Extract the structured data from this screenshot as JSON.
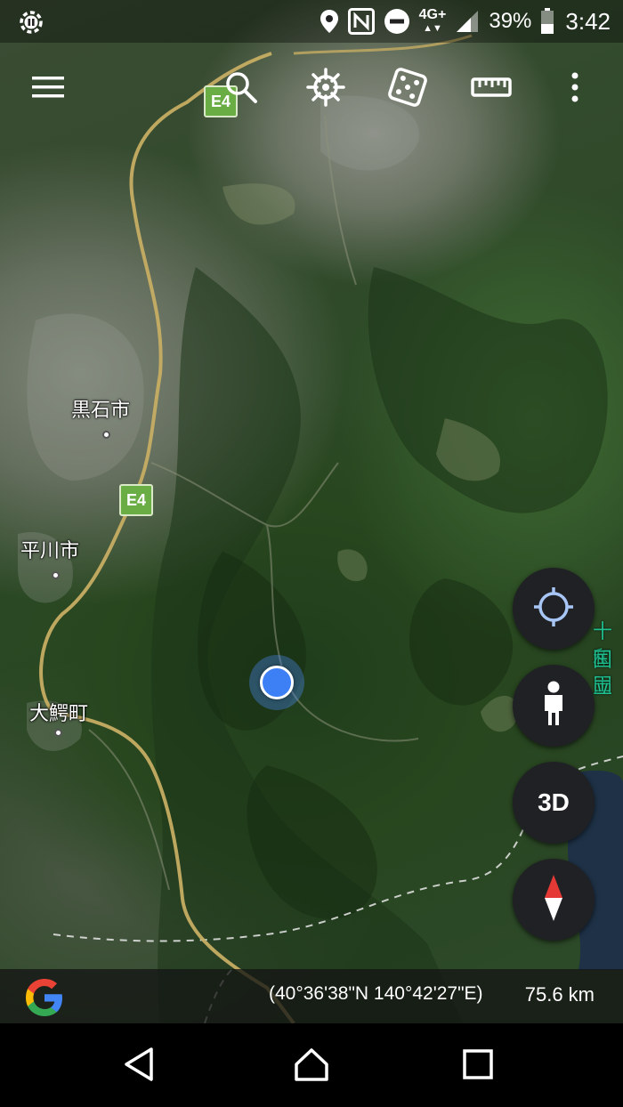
{
  "status_bar": {
    "battery_percent": "39%",
    "time": "3:42",
    "network": "4G+",
    "icons": [
      "sync-icon",
      "location-icon",
      "nfc-icon",
      "do-not-disturb-icon",
      "signal-icon",
      "battery-icon"
    ]
  },
  "toolbar": {
    "icons": [
      "menu-icon",
      "search-icon",
      "voyager-icon",
      "random-dice-icon",
      "measure-ruler-icon",
      "more-vert-icon"
    ]
  },
  "map": {
    "labels": {
      "kuroishi": "黒石市",
      "hirakawa": "平川市",
      "owani": "大鰐町",
      "park_line1": "十和田",
      "park_line2": "国立"
    },
    "route_shields": {
      "top": "E4",
      "middle": "E4"
    }
  },
  "fabs": {
    "three_d_label": "3D",
    "icons": [
      "my-location-icon",
      "pegman-icon",
      "compass-icon"
    ]
  },
  "info_bar": {
    "coordinates": "(40°36'38\"N 140°42'27\"E)",
    "distance": "75.6 km"
  },
  "colors": {
    "location_blue": "#3d7ff5",
    "route_green": "#6aad45",
    "fab_background": "#202124",
    "park_label_green": "#1fbf8e"
  }
}
